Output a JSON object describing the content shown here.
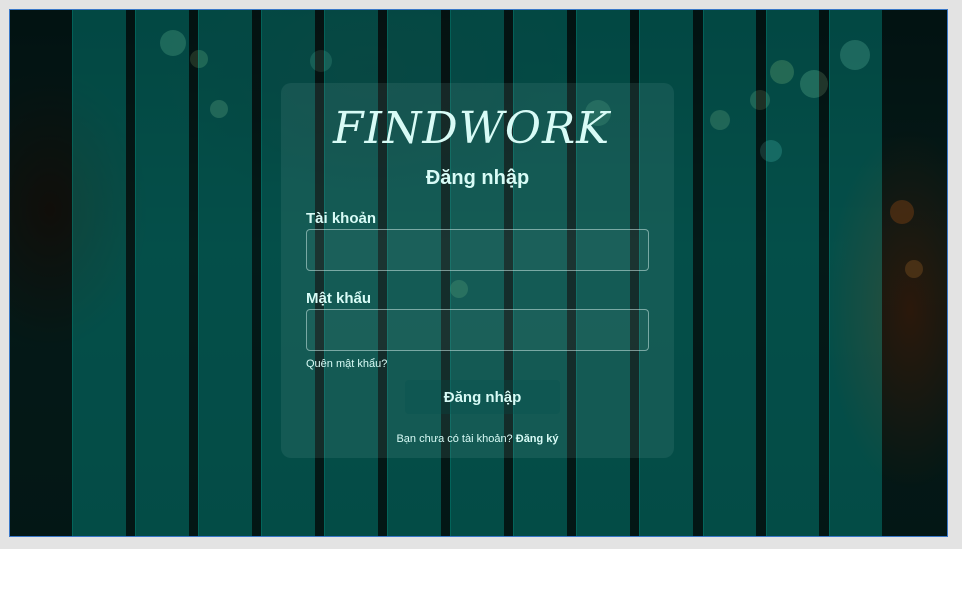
{
  "app": {
    "logo_text": "FINDWORK"
  },
  "login_form": {
    "title": "Đăng nhập",
    "username_label": "Tài khoản",
    "username_value": "",
    "password_label": "Mật khẩu",
    "password_value": "",
    "forgot_password": "Quên mật khẩu?",
    "submit_label": "Đăng nhập",
    "no_account_text": "Bạn chưa có tài khoản?",
    "signup_link": "Đăng ký"
  },
  "theme": {
    "accent_text": "#d8fbf6",
    "stripe_color": "#00605a",
    "frame_border": "#3a78c8"
  }
}
